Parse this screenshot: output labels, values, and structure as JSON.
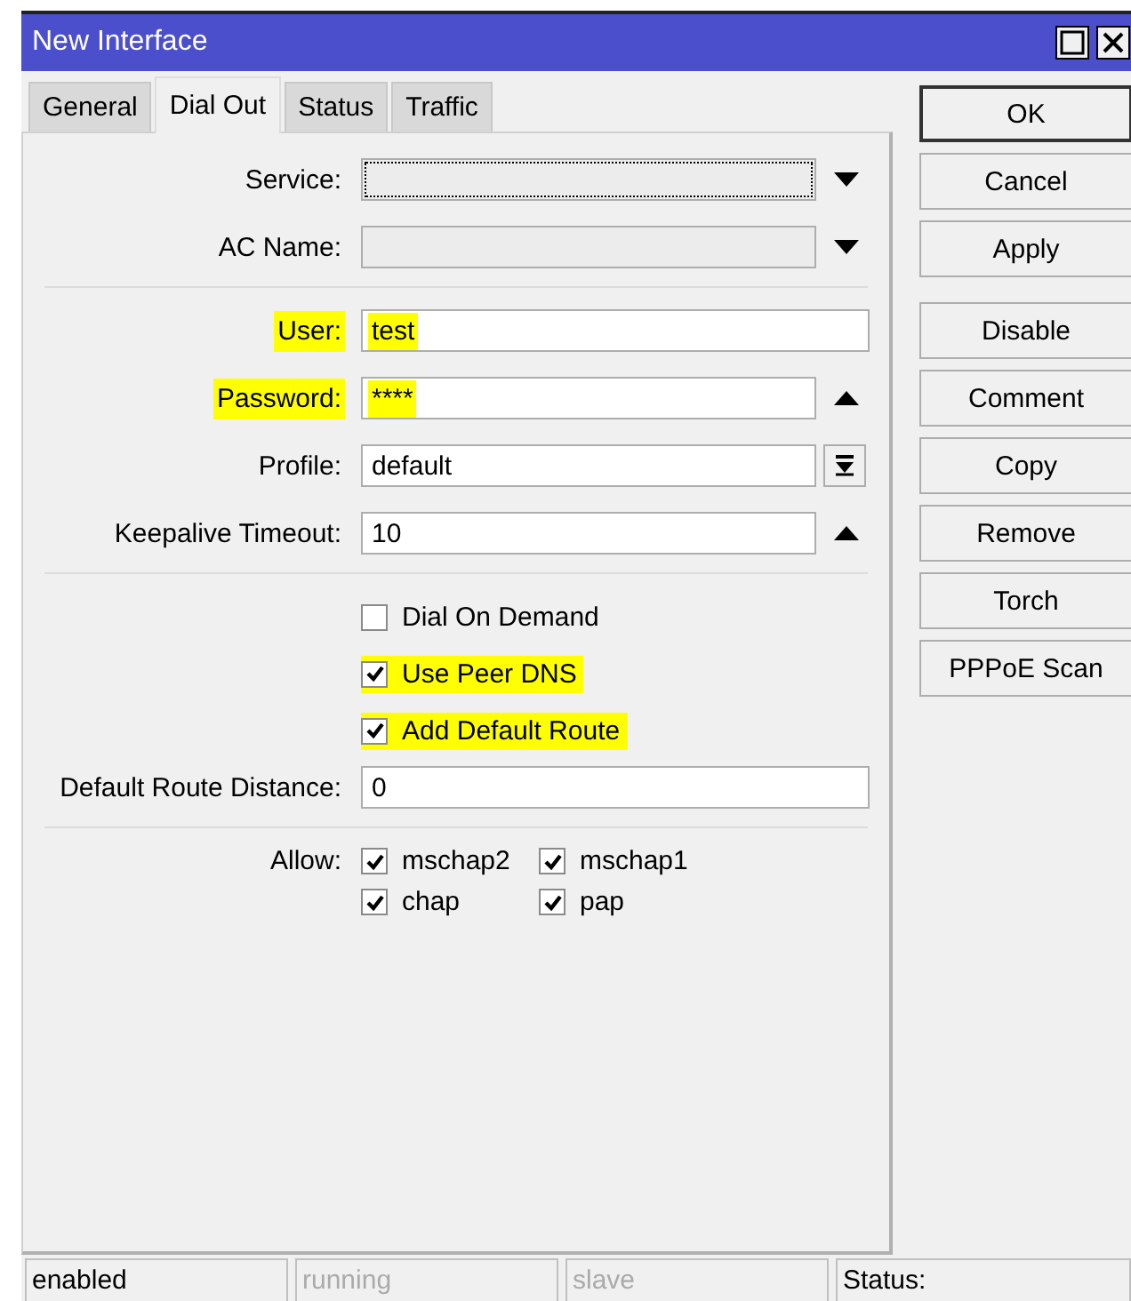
{
  "window": {
    "title": "New Interface"
  },
  "tabs": [
    {
      "label": "General",
      "selected": false
    },
    {
      "label": "Dial Out",
      "selected": true
    },
    {
      "label": "Status",
      "selected": false
    },
    {
      "label": "Traffic",
      "selected": false
    }
  ],
  "sections": [
    {
      "rows": [
        {
          "kind": "dropdown",
          "label": "Service:",
          "focused": true,
          "highlighted": false
        },
        {
          "kind": "dropdown",
          "label": "AC Name:",
          "focused": false,
          "highlighted": false
        }
      ]
    },
    {
      "rows": [
        {
          "kind": "text",
          "label": "User:",
          "value": "test",
          "highlighted": true
        },
        {
          "kind": "spin",
          "label": "Password:",
          "value": "****",
          "highlighted": true
        },
        {
          "kind": "combo",
          "label": "Profile:",
          "value": "default",
          "highlighted": false
        },
        {
          "kind": "spin",
          "label": "Keepalive Timeout:",
          "value": "10",
          "highlighted": false
        }
      ]
    },
    {
      "rows": [
        {
          "kind": "checkbox",
          "label": "Dial On Demand",
          "checked": false,
          "highlighted": false
        },
        {
          "kind": "checkbox",
          "label": "Use Peer DNS",
          "checked": true,
          "highlighted": true
        },
        {
          "kind": "checkbox",
          "label": "Add Default Route",
          "checked": true,
          "highlighted": true
        },
        {
          "kind": "text",
          "label": "Default Route Distance:",
          "value": "0",
          "highlighted": false
        }
      ]
    },
    {
      "rows": [
        {
          "kind": "checkgroup",
          "label": "Allow:",
          "highlighted": false,
          "options": [
            {
              "label": "mschap2",
              "checked": true
            },
            {
              "label": "mschap1",
              "checked": true
            },
            {
              "label": "chap",
              "checked": true
            },
            {
              "label": "pap",
              "checked": true
            }
          ]
        }
      ]
    }
  ],
  "buttons": [
    [
      {
        "label": "OK",
        "default": true
      },
      {
        "label": "Cancel",
        "default": false
      },
      {
        "label": "Apply",
        "default": false
      }
    ],
    [
      {
        "label": "Disable",
        "default": false
      },
      {
        "label": "Comment",
        "default": false
      },
      {
        "label": "Copy",
        "default": false
      },
      {
        "label": "Remove",
        "default": false
      },
      {
        "label": "Torch",
        "default": false
      },
      {
        "label": "PPPoE Scan",
        "default": false
      }
    ]
  ],
  "status_bar": [
    {
      "text": "enabled",
      "disabled": false
    },
    {
      "text": "running",
      "disabled": true
    },
    {
      "text": "slave",
      "disabled": true
    },
    {
      "text": "Status:",
      "disabled": false
    }
  ]
}
